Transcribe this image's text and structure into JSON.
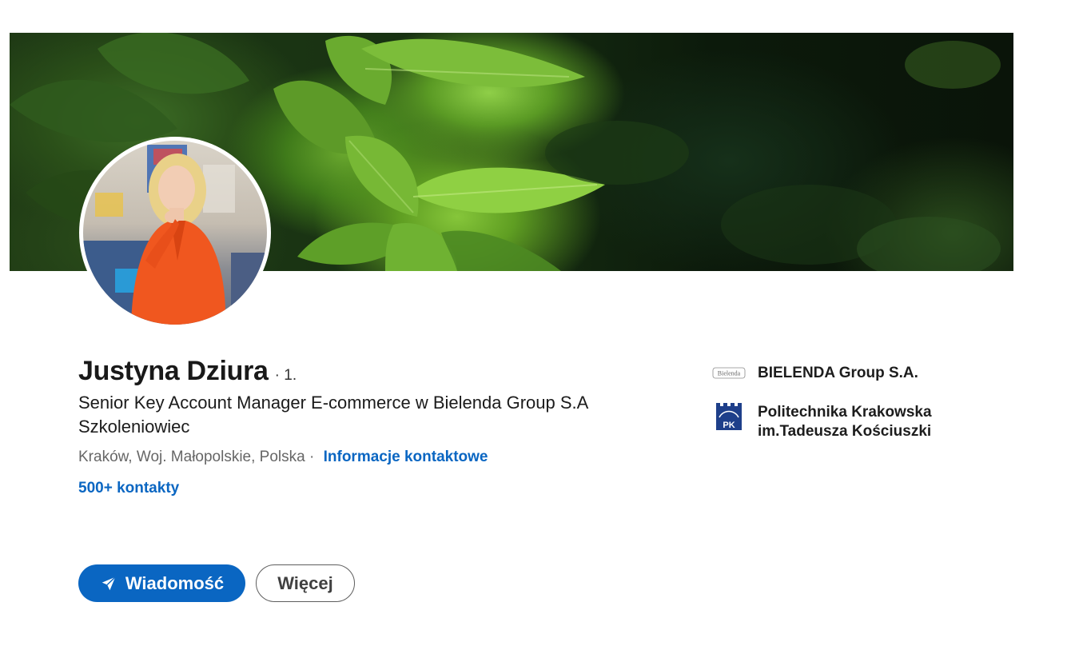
{
  "profile": {
    "name": "Justyna Dziura",
    "degree": "· 1.",
    "headline": "Senior Key Account Manager E-commerce w Bielenda Group S.A Szkoleniowiec",
    "location": "Kraków, Woj. Małopolskie, Polska",
    "location_separator": "·",
    "contact_info_link": "Informacje kontaktowe",
    "connections": "500+ kontakty"
  },
  "actions": {
    "message_label": "Wiadomość",
    "more_label": "Więcej"
  },
  "experience": {
    "company_name": "BIELENDA Group S.A.",
    "company_logo_text": "Bielenda"
  },
  "education": {
    "school_name": "Politechnika Krakowska im.Tadeusza Kościuszki",
    "school_logo_text": "PK"
  },
  "colors": {
    "link_blue": "#0a66c2",
    "text_primary": "#191919",
    "text_secondary": "#666666"
  },
  "icons": {
    "message_button_icon": "send-icon"
  }
}
